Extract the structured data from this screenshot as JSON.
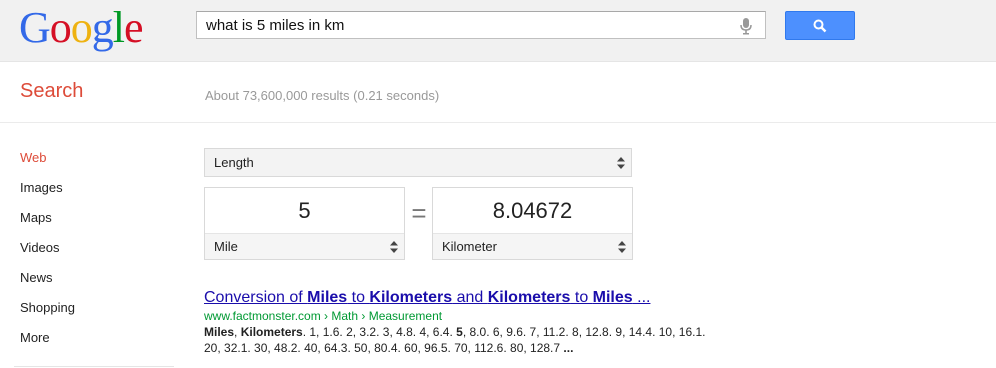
{
  "logo": {
    "letters": [
      "G",
      "o",
      "o",
      "g",
      "l",
      "e"
    ]
  },
  "search": {
    "query": "what is 5 miles in km"
  },
  "icons": {
    "mic": "microphone-icon",
    "search": "magnifier-icon",
    "select_arrows": "up-down-arrows-icon"
  },
  "colors": {
    "accent_red": "#dd4b39",
    "link_blue": "#1a0dab",
    "url_green": "#009933",
    "button_blue": "#4d90fe"
  },
  "subheader": {
    "title": "Search",
    "stats": "About 73,600,000 results (0.21 seconds)"
  },
  "nav": {
    "items": [
      "Web",
      "Images",
      "Maps",
      "Videos",
      "News",
      "Shopping",
      "More"
    ],
    "active": "Web"
  },
  "converter": {
    "unit_type": "Length",
    "left_value": "5",
    "left_unit": "Mile",
    "equals": "=",
    "right_value": "8.04672",
    "right_unit": "Kilometer"
  },
  "result": {
    "title_parts": [
      "Conversion of ",
      "Miles",
      " to ",
      "Kilometers",
      " and ",
      "Kilometers",
      " to ",
      "Miles",
      " ..."
    ],
    "url": "www.factmonster.com › Math › Measurement",
    "snippet_parts": [
      "Miles",
      ", ",
      "Kilometers",
      ". 1, 1.6. 2, 3.2. 3, 4.8. 4, 6.4. ",
      "5",
      ", 8.0. 6, 9.6. 7, 11.2. 8, 12.8. 9, 14.4. 10, 16.1. 20, 32.1. 30, 48.2. 40, 64.3. 50, 80.4. 60, 96.5. 70, 112.6. 80, 128.7 ",
      "..."
    ]
  }
}
